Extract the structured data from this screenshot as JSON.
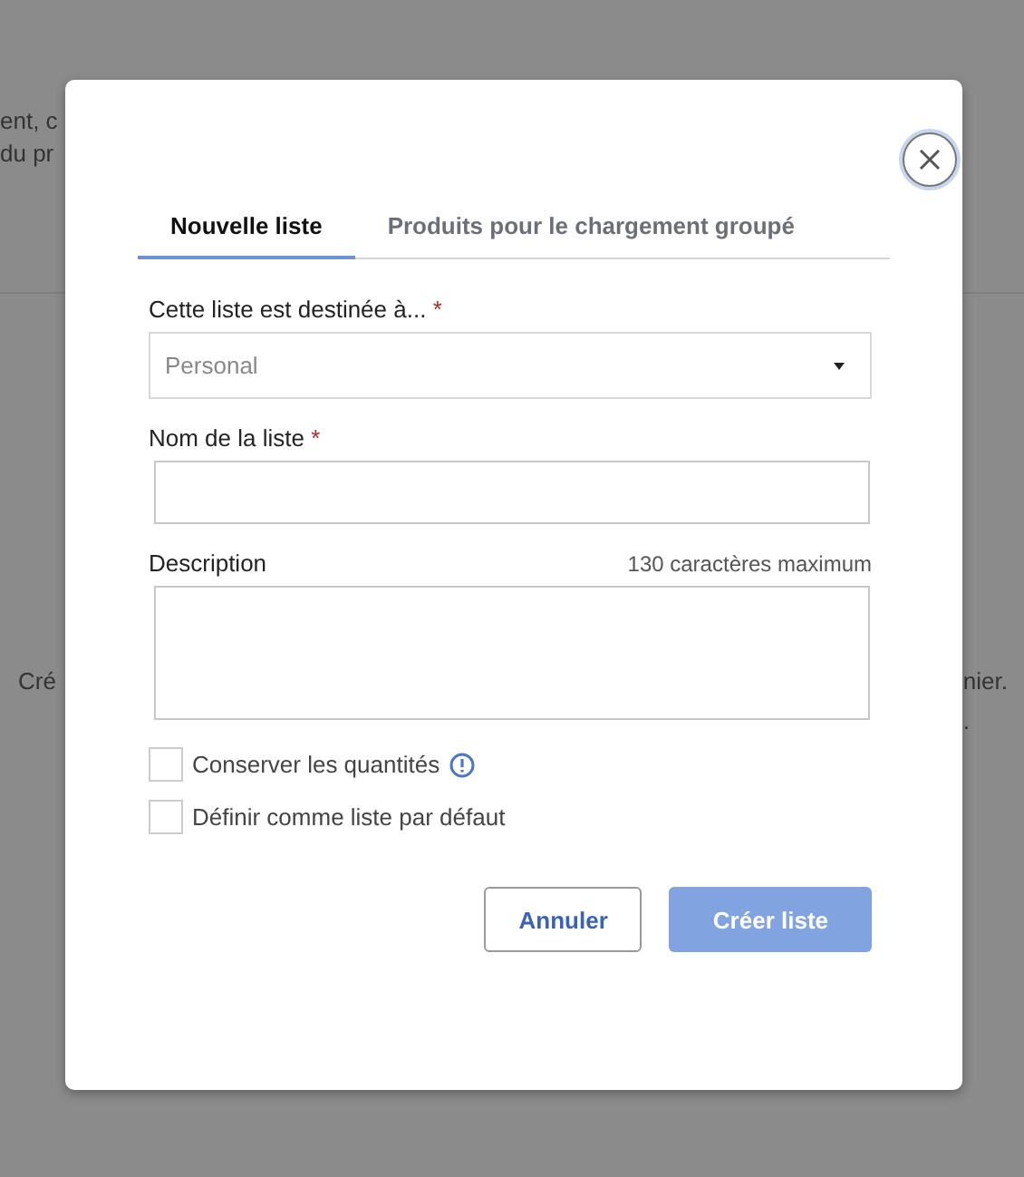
{
  "backdrop": {
    "top_lines": [
      "ent, c",
      "du pr"
    ],
    "bottom_rows": [
      {
        "left": "Cré",
        "right": "nier."
      },
      {
        "right": "."
      }
    ]
  },
  "dialog": {
    "tabs": [
      {
        "label": "Nouvelle liste",
        "selected": true
      },
      {
        "label": "Produits pour le chargement groupé",
        "selected": false
      }
    ],
    "fields": [
      {
        "kind": "select",
        "label": "Cette liste est destinée à...",
        "required_mark": "*",
        "value": "Personal"
      },
      {
        "kind": "input",
        "label": "Nom de la liste",
        "required_mark": "*"
      },
      {
        "kind": "textarea",
        "label": "Description",
        "hint": "130 caractères maximum"
      }
    ],
    "checkboxes": [
      {
        "label": "Conserver les quantités",
        "checked": false,
        "info": true
      },
      {
        "label": "Définir comme liste par défaut",
        "checked": false,
        "info": false
      }
    ],
    "buttons": [
      {
        "label": "Annuler",
        "kind": "secondary"
      },
      {
        "label": "Créer liste",
        "kind": "primary",
        "disabled": true
      }
    ]
  }
}
